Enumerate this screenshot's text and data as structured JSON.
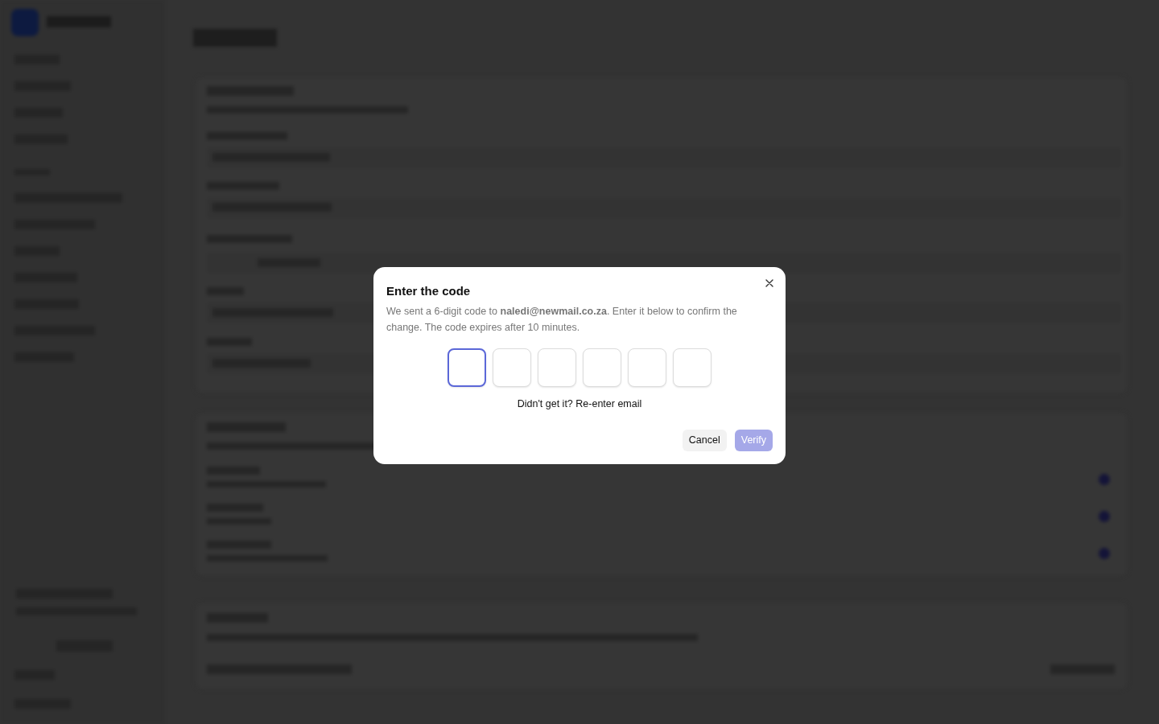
{
  "dialog": {
    "title": "Enter the code",
    "message": "We sent a 6-digit code to **naledi@newmail.co.za**. Enter it below to confirm the change. The code expires after 10 minutes.",
    "code_boxes": [
      {
        "focused": true
      },
      {
        "focused": false
      },
      {
        "focused": false
      },
      {
        "focused": false
      },
      {
        "focused": false
      },
      {
        "focused": false
      }
    ],
    "resend": "Didn't get it? Re-enter email",
    "buttons": [
      {
        "label": "Cancel",
        "kind": "secondary",
        "disabled": false
      },
      {
        "label": "Verify",
        "kind": "primary",
        "disabled": true
      }
    ]
  }
}
